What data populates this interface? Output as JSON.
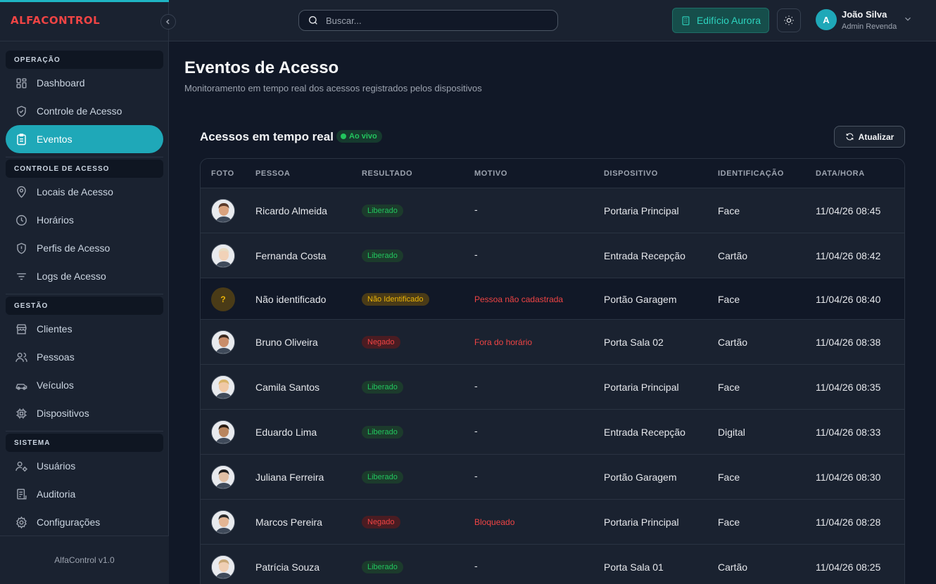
{
  "brand": {
    "part1": "ALFA",
    "part2": "CONTROL"
  },
  "sidebar": {
    "sections": [
      {
        "label": "OPERAÇÃO",
        "items": [
          {
            "label": "Dashboard",
            "icon": "dashboard-icon"
          },
          {
            "label": "Controle de Acesso",
            "icon": "shield-check-icon"
          },
          {
            "label": "Eventos",
            "icon": "clipboard-icon",
            "active": true
          }
        ]
      },
      {
        "label": "CONTROLE DE ACESSO",
        "items": [
          {
            "label": "Locais de Acesso",
            "icon": "map-pin-icon"
          },
          {
            "label": "Horários",
            "icon": "clock-icon"
          },
          {
            "label": "Perfis de Acesso",
            "icon": "shield-alert-icon"
          },
          {
            "label": "Logs de Acesso",
            "icon": "filter-lines-icon"
          }
        ]
      },
      {
        "label": "GESTÃO",
        "items": [
          {
            "label": "Clientes",
            "icon": "store-icon"
          },
          {
            "label": "Pessoas",
            "icon": "users-icon"
          },
          {
            "label": "Veículos",
            "icon": "car-icon"
          },
          {
            "label": "Dispositivos",
            "icon": "chip-icon"
          }
        ]
      },
      {
        "label": "SISTEMA",
        "items": [
          {
            "label": "Usuários",
            "icon": "user-cog-icon"
          },
          {
            "label": "Auditoria",
            "icon": "audit-icon"
          },
          {
            "label": "Configurações",
            "icon": "settings-icon"
          }
        ]
      }
    ],
    "footer": "AlfaControl v1.0"
  },
  "header": {
    "search_placeholder": "Buscar...",
    "building": "Edifício Aurora",
    "user_initial": "A",
    "user_name": "João Silva",
    "user_role": "Admin Revenda"
  },
  "main": {
    "title": "Eventos de Acesso",
    "subtitle": "Monitoramento em tempo real dos acessos registrados pelos dispositivos",
    "section_title": "Acessos em tempo real",
    "live_label": "Ao vivo",
    "refresh_label": "Atualizar"
  },
  "table": {
    "columns": [
      "FOTO",
      "PESSOA",
      "RESULTADO",
      "MOTIVO",
      "DISPOSITIVO",
      "IDENTIFICAÇÃO",
      "DATA/HORA"
    ],
    "rows": [
      {
        "person": "Ricardo Almeida",
        "result": "Liberado",
        "status": "ok",
        "reason": "-",
        "device": "Portaria Principal",
        "id_method": "Face",
        "datetime": "11/04/26 08:45",
        "hair": "#5b3a29",
        "skin": "#d9a27e"
      },
      {
        "person": "Fernanda Costa",
        "result": "Liberado",
        "status": "ok",
        "reason": "-",
        "device": "Entrada Recepção",
        "id_method": "Cartão",
        "datetime": "11/04/26 08:42",
        "hair": "#e8dcc4",
        "skin": "#f1d2b8"
      },
      {
        "person": "Não identificado",
        "result": "Não Identificado",
        "status": "unk",
        "reason": "Pessoa não cadastrada",
        "device": "Portão Garagem",
        "id_method": "Face",
        "datetime": "11/04/26 08:40",
        "photo_text": "?"
      },
      {
        "person": "Bruno Oliveira",
        "result": "Negado",
        "status": "no",
        "reason": "Fora do horário",
        "device": "Porta Sala 02",
        "id_method": "Cartão",
        "datetime": "11/04/26 08:38",
        "hair": "#3b2a20",
        "skin": "#c98d6a"
      },
      {
        "person": "Camila Santos",
        "result": "Liberado",
        "status": "ok",
        "reason": "-",
        "device": "Portaria Principal",
        "id_method": "Face",
        "datetime": "11/04/26 08:35",
        "hair": "#d9b46a",
        "skin": "#f0c9a6"
      },
      {
        "person": "Eduardo Lima",
        "result": "Liberado",
        "status": "ok",
        "reason": "-",
        "device": "Entrada Recepção",
        "id_method": "Digital",
        "datetime": "11/04/26 08:33",
        "hair": "#2a1d14",
        "skin": "#b9855e"
      },
      {
        "person": "Juliana Ferreira",
        "result": "Liberado",
        "status": "ok",
        "reason": "-",
        "device": "Portão Garagem",
        "id_method": "Face",
        "datetime": "11/04/26 08:30",
        "hair": "#1f1f1f",
        "skin": "#e0bfa4"
      },
      {
        "person": "Marcos Pereira",
        "result": "Negado",
        "status": "no",
        "reason": "Bloqueado",
        "device": "Portaria Principal",
        "id_method": "Face",
        "datetime": "11/04/26 08:28",
        "hair": "#2b2b2b",
        "skin": "#e3b594"
      },
      {
        "person": "Patrícia Souza",
        "result": "Liberado",
        "status": "ok",
        "reason": "-",
        "device": "Porta Sala 01",
        "id_method": "Cartão",
        "datetime": "11/04/26 08:25",
        "hair": "#c8a878",
        "skin": "#efcfb4"
      }
    ]
  },
  "colors": {
    "accent": "#1fa8b8",
    "ok": "#22c55e",
    "denied": "#ef4444",
    "unknown": "#eab308"
  }
}
